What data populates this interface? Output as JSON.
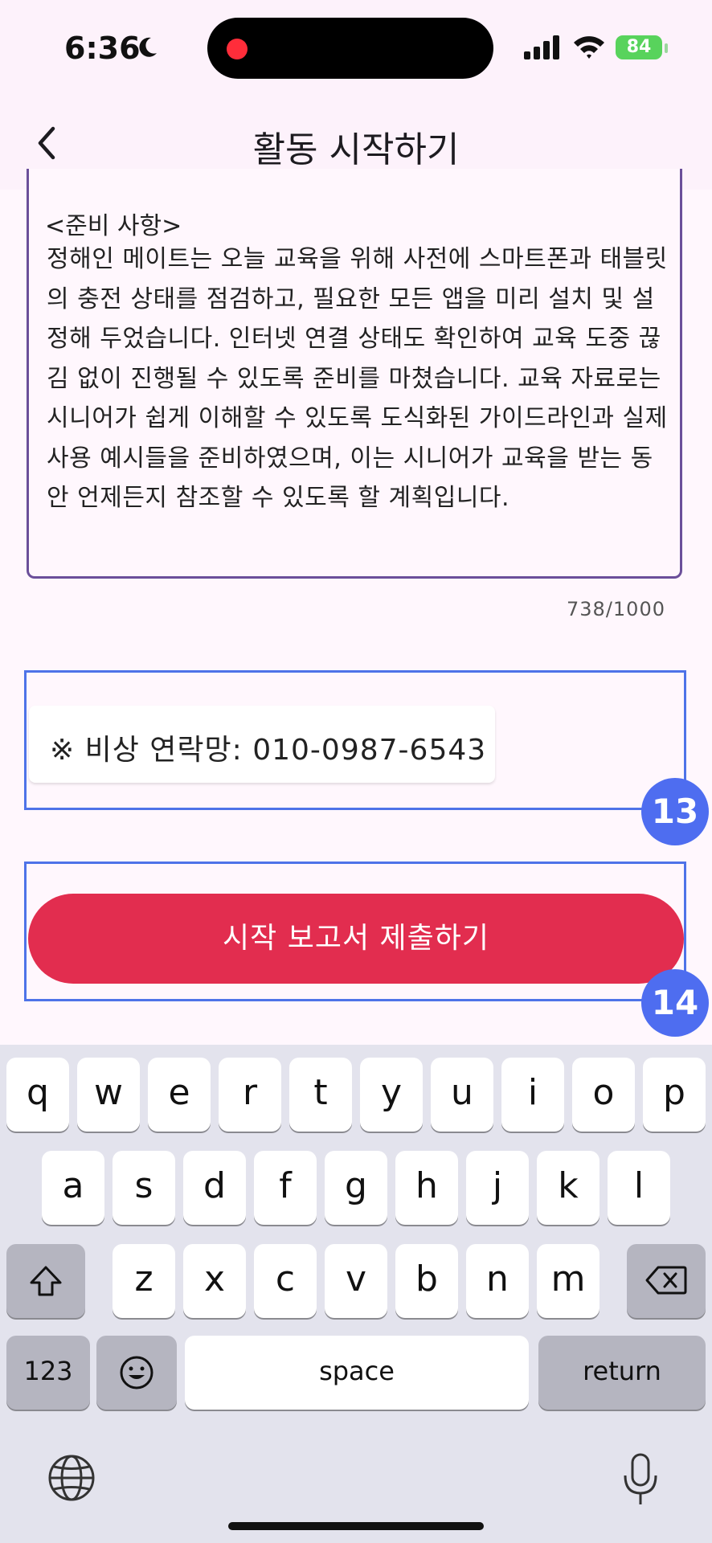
{
  "status": {
    "time": "6:36",
    "battery": "84"
  },
  "header": {
    "title": "활동 시작하기"
  },
  "report": {
    "section_label_partial": "<준비 사항>",
    "text": "정해인 메이트는 오늘 교육을 위해 사전에 스마트폰과 태블릿의 충전 상태를 점검하고, 필요한 모든 앱을 미리 설치 및 설정해 두었습니다. 인터넷 연결 상태도 확인하여 교육 도중 끊김 없이 진행될 수 있도록 준비를 마쳤습니다. 교육 자료로는 시니어가 쉽게 이해할 수 있도록 도식화된 가이드라인과 실제 사용 예시들을 준비하였으며, 이는 시니어가 교육을 받는 동안 언제든지 참조할 수 있도록 할 계획입니다.",
    "counter": "738/1000"
  },
  "emergency": {
    "text": "※ 비상 연락망: 010-0987-6543"
  },
  "submit": {
    "label": "시작 보고서 제출하기"
  },
  "badges": {
    "a": "13",
    "b": "14"
  },
  "keyboard": {
    "row1": [
      "q",
      "w",
      "e",
      "r",
      "t",
      "y",
      "u",
      "i",
      "o",
      "p"
    ],
    "row2": [
      "a",
      "s",
      "d",
      "f",
      "g",
      "h",
      "j",
      "k",
      "l"
    ],
    "row3": [
      "z",
      "x",
      "c",
      "v",
      "b",
      "n",
      "m"
    ],
    "numbers": "123",
    "space": "space",
    "return": "return"
  },
  "colors": {
    "accent": "#e22d4f",
    "highlight": "#4e73e8",
    "border": "#6b4f9a"
  }
}
